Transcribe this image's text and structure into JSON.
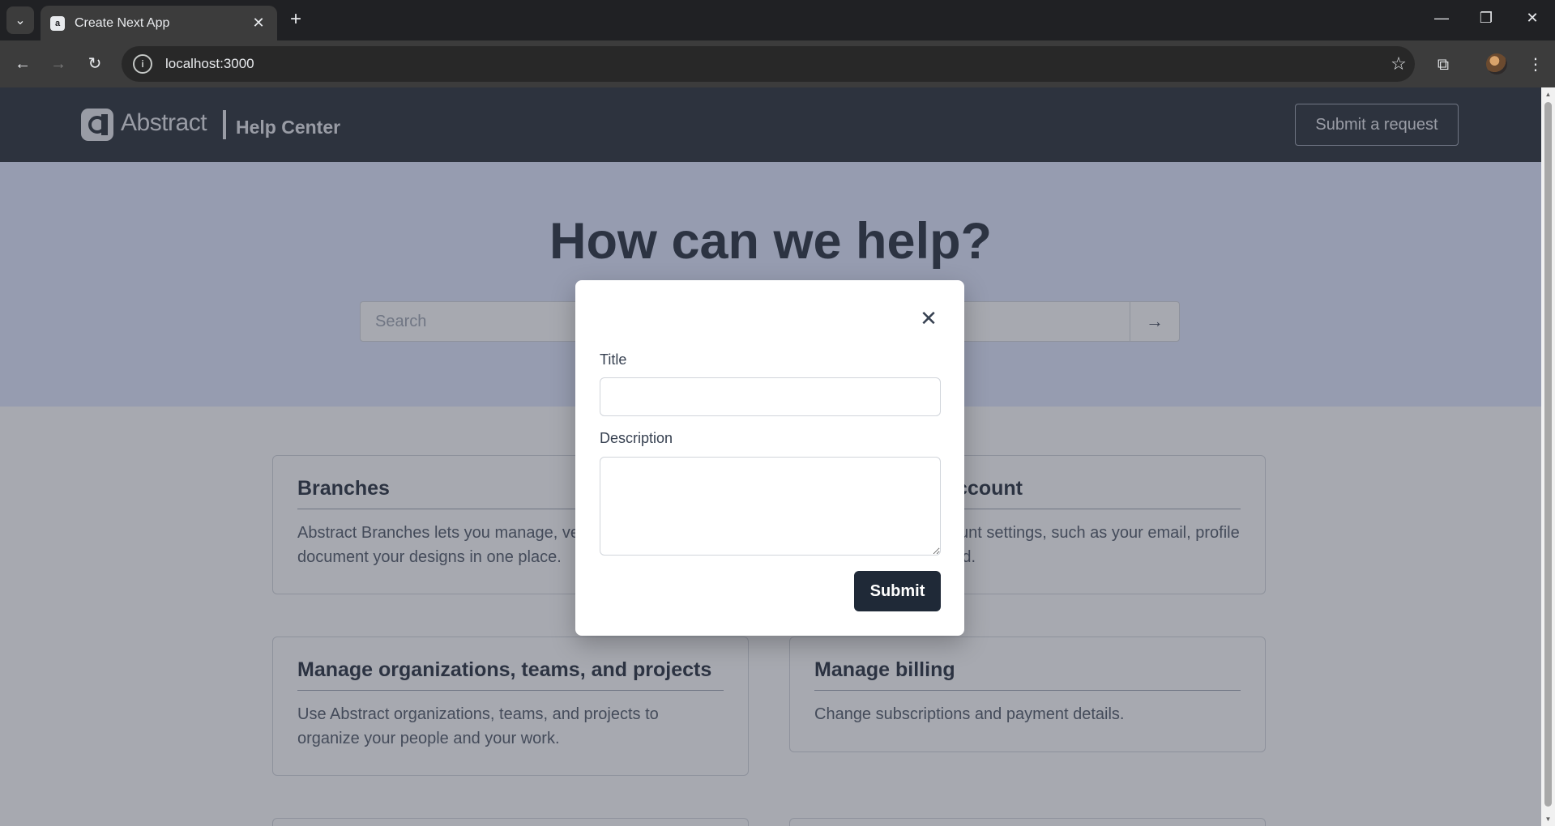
{
  "browser": {
    "tab_title": "Create Next App",
    "url": "localhost:3000"
  },
  "header": {
    "logo_text": "Abstract",
    "help_center": "Help Center",
    "request_button": "Submit a request"
  },
  "hero": {
    "title": "How can we help?",
    "search_placeholder": "Search",
    "search_button": "→"
  },
  "cards": [
    {
      "title": "Branches",
      "description": "Abstract Branches lets you manage, version, and document your designs in one place."
    },
    {
      "title": "Manage your account",
      "description": "Configure your account settings, such as your email, profile details, and password."
    },
    {
      "title": "Manage organizations, teams, and projects",
      "description": "Use Abstract organizations, teams, and projects to organize your people and your work."
    },
    {
      "title": "Manage billing",
      "description": "Change subscriptions and payment details."
    }
  ],
  "modal": {
    "title_label": "Title",
    "title_value": "",
    "description_label": "Description",
    "description_value": "",
    "submit_label": "Submit",
    "close_glyph": "✕"
  }
}
